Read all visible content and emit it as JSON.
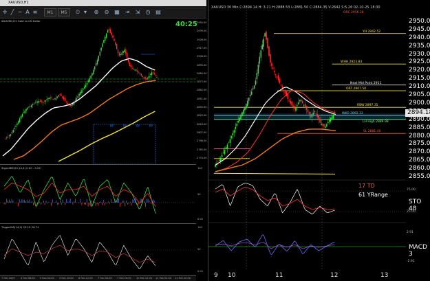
{
  "left_window": {
    "title": "XAUUSD,H1",
    "timer": "40:25",
    "chart_caption": "XAUUSD,H1  Gold vs US Dollar",
    "price_axis": [
      "2950.00",
      "2939.00",
      "2928.00",
      "2917.00",
      "2906.00",
      "2895.00",
      "2884.00",
      "2873.00",
      "2862.00",
      "2851.00",
      "2840.00",
      "2829.00",
      "2818.00",
      "2807.00",
      "2796.00",
      "2785.00",
      "2774.00"
    ],
    "stoch_label": "SignalRM(20,14,4) 0.00 - 0.00",
    "stoch_axis": [
      "100",
      "50",
      "0.00"
    ],
    "osc_label": "TriggerMA(14,0) 25.19 26.74",
    "osc_axis": [
      "100",
      "50",
      "0.00"
    ],
    "x_labels": [
      "7 Feb 2025",
      "4 Feb 08:00",
      "5 Feb 04:00",
      "5 Feb 20:00",
      "6 Feb 12:00",
      "7 Feb 04:00",
      "7 Feb 20:00",
      "10 Feb 12:00",
      "11 Feb 04:00",
      "11 Feb 20:00"
    ],
    "box_markers": [
      "PP",
      "PP",
      "PP",
      "PP"
    ],
    "colors": {
      "up": "#3ddc3d",
      "down": "#ff2a2a",
      "ma_white": "#ffffff",
      "ma_orange": "#f07a1a",
      "ma_yellow": "#f5e33c",
      "box": "#2f7bff"
    }
  },
  "right_window": {
    "ohlc": "XAUUSD  30 Min   C:2894.14   H: 3.21   H:2888.53   L:2881.50   C:2884.35   V:2642   S:5.26  02-10-25  18:30",
    "price_labels": [
      "2950.00",
      "2945.00",
      "2940.00",
      "2935.00",
      "2930.00",
      "2925.00",
      "2920.00",
      "2915.00",
      "2910.00",
      "2905.00",
      "2900.00",
      "2895.00",
      "2890.00",
      "2885.00",
      "2880.00",
      "2875.00",
      "2870.00",
      "2865.00",
      "2860.00",
      "2855.00"
    ],
    "last_price": "2894.18",
    "annotations": [
      {
        "text": "ORC 2956.28",
        "color": "#ff5533"
      },
      {
        "text": "YH 2942.52",
        "color": "#f5e33c"
      },
      {
        "text": "WHH 2923.83",
        "color": "#f5e33c"
      },
      {
        "text": "Next Mid Point 2911",
        "color": "#ffffff"
      },
      {
        "text": "ORT 2907.50",
        "color": "#f5e33c"
      },
      {
        "text": "RBW 2897.35",
        "color": "#f5e33c"
      },
      {
        "text": "WKO 2892.33",
        "color": "#7fd8ff"
      },
      {
        "text": "LH High 2889.98",
        "color": "#7fff7f"
      },
      {
        "text": "SL 2881.40",
        "color": "#ff5533"
      }
    ],
    "td_label": "17 TD",
    "yrange_label": "61 YRange",
    "sto_label": "STO 48",
    "sto_axis": [
      "75.00",
      "25.00"
    ],
    "macd_label": "MACD 3",
    "macd_axis": [
      "2.91",
      "-2.91"
    ],
    "x_labels": [
      "9",
      "10",
      "11",
      "12",
      "13"
    ]
  }
}
